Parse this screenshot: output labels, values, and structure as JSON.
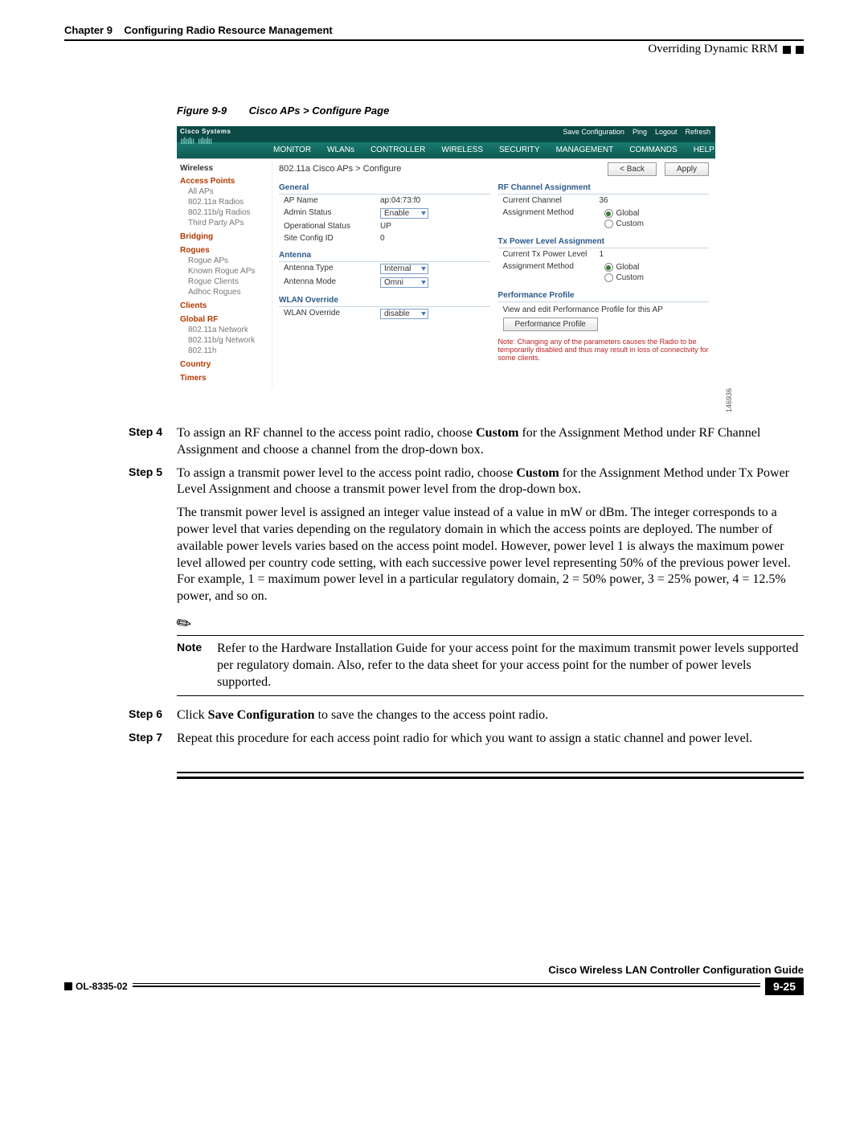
{
  "header": {
    "chapter_label": "Chapter 9",
    "chapter_title": "Configuring Radio Resource Management",
    "section_title": "Overriding Dynamic RRM"
  },
  "figure": {
    "label": "Figure 9-9",
    "caption": "Cisco APs > Configure Page",
    "image_id": "146936"
  },
  "screenshot": {
    "logo": "Cisco Systems",
    "topbar": {
      "save": "Save Configuration",
      "ping": "Ping",
      "logout": "Logout",
      "refresh": "Refresh"
    },
    "menu": [
      "MONITOR",
      "WLANs",
      "CONTROLLER",
      "WIRELESS",
      "SECURITY",
      "MANAGEMENT",
      "COMMANDS",
      "HELP"
    ],
    "side": {
      "heading": "Wireless",
      "sections": [
        {
          "title": "Access Points",
          "items": [
            "All APs",
            "802.11a Radios",
            "802.11b/g Radios",
            "Third Party APs"
          ]
        },
        {
          "title": "Bridging",
          "items": []
        },
        {
          "title": "Rogues",
          "items": [
            "Rogue APs",
            "Known Rogue APs",
            "Rogue Clients",
            "Adhoc Rogues"
          ]
        },
        {
          "title": "Clients",
          "items": []
        },
        {
          "title": "Global RF",
          "items": [
            "802.11a Network",
            "802.11b/g Network",
            "802.11h"
          ]
        },
        {
          "title": "Country",
          "items": []
        },
        {
          "title": "Timers",
          "items": []
        }
      ]
    },
    "breadcrumb": "802.11a Cisco APs > Configure",
    "buttons": {
      "back": "< Back",
      "apply": "Apply"
    },
    "left_panels": {
      "general_h": "General",
      "general": {
        "ap_name_k": "AP Name",
        "ap_name_v": "ap:04:73:f0",
        "admin_k": "Admin Status",
        "admin_v": "Enable",
        "oper_k": "Operational Status",
        "oper_v": "UP",
        "site_k": "Site Config ID",
        "site_v": "0"
      },
      "antenna_h": "Antenna",
      "antenna": {
        "type_k": "Antenna Type",
        "type_v": "Internal",
        "mode_k": "Antenna Mode",
        "mode_v": "Omni"
      },
      "override_h": "WLAN Override",
      "override": {
        "k": "WLAN Override",
        "v": "disable"
      }
    },
    "right_panels": {
      "rf_h": "RF Channel Assignment",
      "rf": {
        "chan_k": "Current Channel",
        "chan_v": "36",
        "method_k": "Assignment Method",
        "global": "Global",
        "custom": "Custom"
      },
      "tx_h": "Tx Power Level Assignment",
      "tx": {
        "level_k": "Current Tx Power Level",
        "level_v": "1",
        "method_k": "Assignment Method",
        "global": "Global",
        "custom": "Custom"
      },
      "perf_h": "Performance Profile",
      "perf_text": "View and edit Performance Profile for this AP",
      "perf_btn": "Performance Profile",
      "warn": "Note: Changing any of the parameters causes the Radio to be temporarily disabled and thus may result in loss of connectivity for some clients."
    }
  },
  "steps": {
    "s4_label": "Step 4",
    "s4_a": "To assign an RF channel to the access point radio, choose ",
    "s4_b": "Custom",
    "s4_c": " for the Assignment Method under RF Channel Assignment and choose a channel from the drop-down box.",
    "s5_label": "Step 5",
    "s5_a": "To assign a transmit power level to the access point radio, choose ",
    "s5_b": "Custom",
    "s5_c": " for the Assignment Method under Tx Power Level Assignment and choose a transmit power level from the drop-down box.",
    "para": "The transmit power level is assigned an integer value instead of a value in mW or dBm. The integer corresponds to a power level that varies depending on the regulatory domain in which the access points are deployed. The number of available power levels varies based on the access point model. However, power level 1 is always the maximum power level allowed per country code setting, with each successive power level representing 50% of the previous power level. For example, 1 = maximum power level in a particular regulatory domain, 2 = 50% power, 3 = 25% power, 4 = 12.5% power, and so on.",
    "note_label": "Note",
    "note": "Refer to the Hardware Installation Guide for your access point for the maximum transmit power levels supported per regulatory domain. Also, refer to the data sheet for your access point for the number of power levels supported.",
    "s6_label": "Step 6",
    "s6_a": "Click ",
    "s6_b": "Save Configuration",
    "s6_c": " to save the changes to the access point radio.",
    "s7_label": "Step 7",
    "s7": "Repeat this procedure for each access point radio for which you want to assign a static channel and power level."
  },
  "footer": {
    "guide": "Cisco Wireless LAN Controller Configuration Guide",
    "doc": "OL-8335-02",
    "page": "9-25"
  }
}
